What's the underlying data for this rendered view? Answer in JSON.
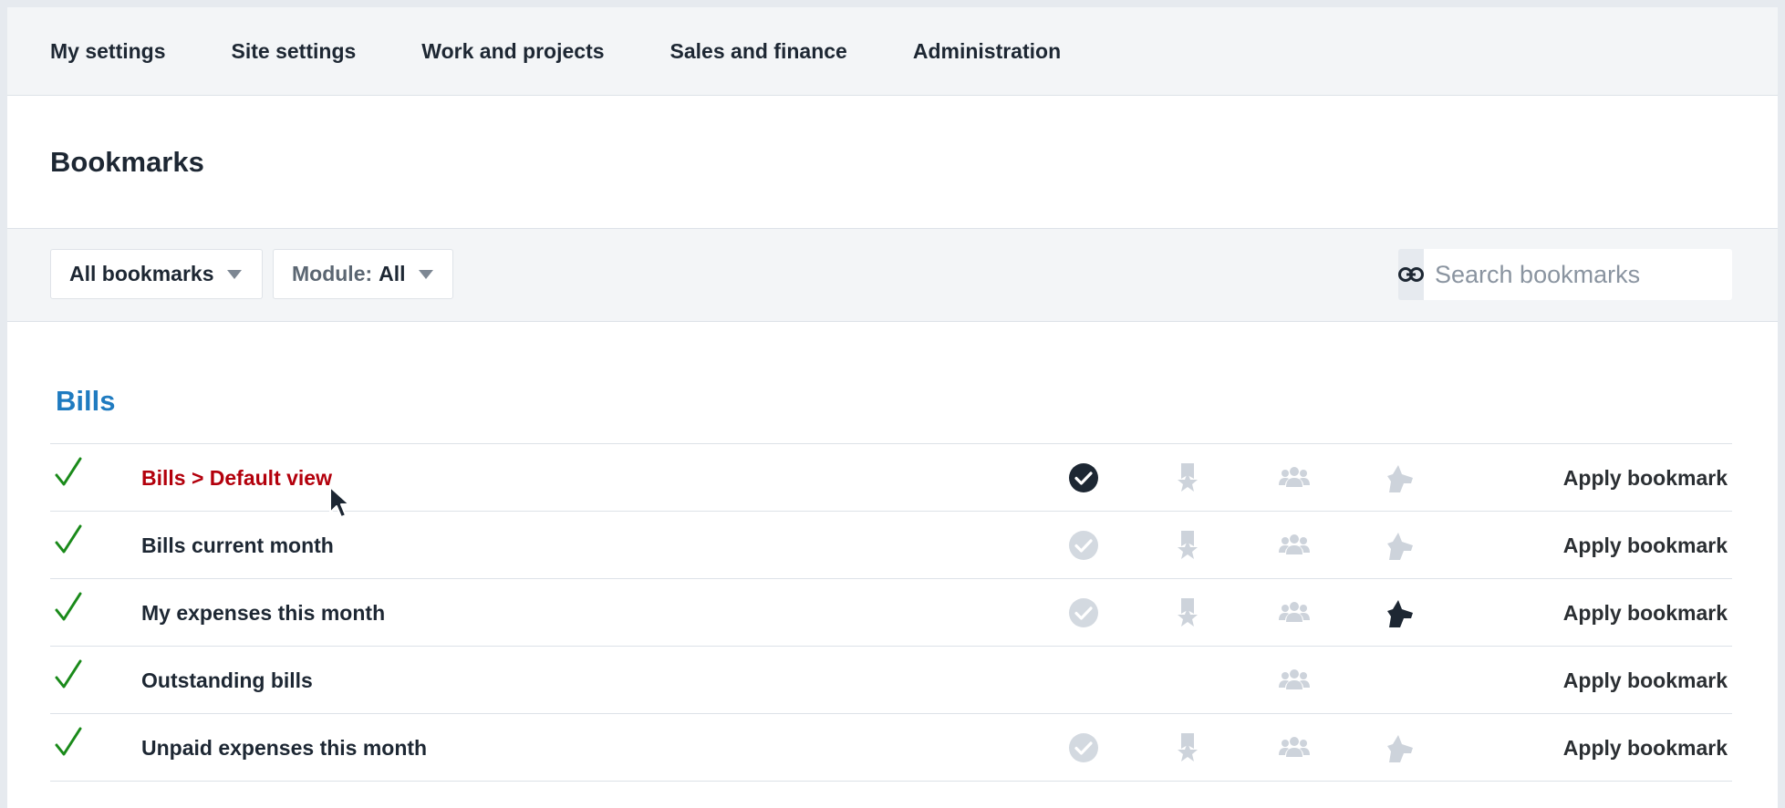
{
  "nav": {
    "items": [
      "My settings",
      "Site settings",
      "Work and projects",
      "Sales and finance",
      "Administration"
    ]
  },
  "header": {
    "title": "Bookmarks"
  },
  "filters": {
    "all_bookmarks": "All bookmarks",
    "module_label": "Module:",
    "module_value": "All",
    "search_placeholder": "Search bookmarks"
  },
  "section": {
    "title": "Bills",
    "apply_label": "Apply bookmark",
    "rows": [
      {
        "name": "Bills > Default view",
        "active": true,
        "default_icon": "check-circle-filled",
        "pin_icon": "pin-star-icon",
        "group_icon": "group-icon",
        "dog_icon": "dog-icon-muted"
      },
      {
        "name": "Bills current month",
        "active": false,
        "default_icon": "check-circle-muted",
        "pin_icon": "pin-star-icon",
        "group_icon": "group-icon",
        "dog_icon": "dog-icon-muted"
      },
      {
        "name": "My expenses this month",
        "active": false,
        "default_icon": "check-circle-muted",
        "pin_icon": "pin-star-icon",
        "group_icon": "group-icon",
        "dog_icon": "dog-icon-filled"
      },
      {
        "name": "Outstanding bills",
        "active": false,
        "default_icon": "",
        "pin_icon": "",
        "group_icon": "group-icon",
        "dog_icon": ""
      },
      {
        "name": "Unpaid expenses this month",
        "active": false,
        "default_icon": "check-circle-muted",
        "pin_icon": "pin-star-icon",
        "group_icon": "group-icon",
        "dog_icon": "dog-icon-muted"
      }
    ]
  },
  "colors": {
    "accent": "#1f7bc0",
    "active_link": "#b3000c",
    "check_green": "#1a8a1a",
    "muted_icon": "#cdd3db",
    "dark_icon": "#1d2733"
  }
}
